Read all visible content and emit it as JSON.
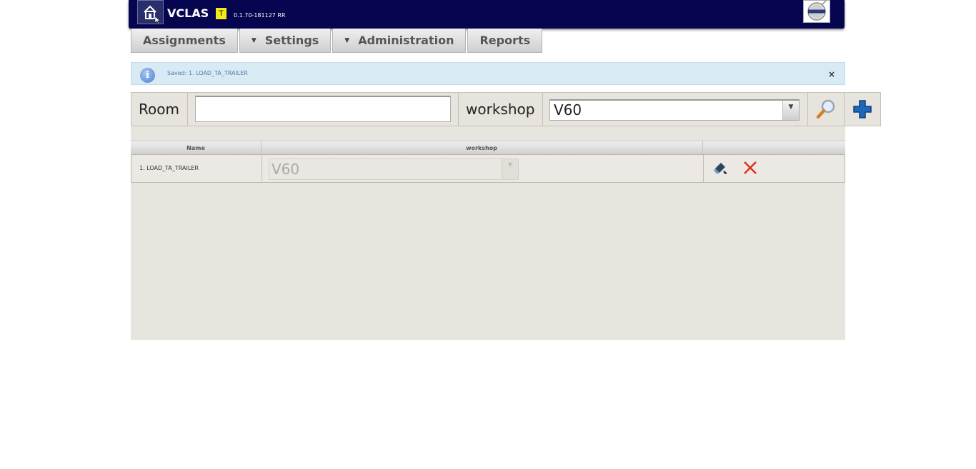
{
  "header": {
    "app_title": "VCLAS",
    "env_badge": "T",
    "version": "0.1.70-181127 RR",
    "logo_icon": "house-cursor-icon",
    "brand_logo": "volvo-logo-icon"
  },
  "menu": {
    "items": [
      {
        "label": "Assignments",
        "has_dropdown": false
      },
      {
        "label": "Settings",
        "has_dropdown": true
      },
      {
        "label": "Administration",
        "has_dropdown": true
      },
      {
        "label": "Reports",
        "has_dropdown": false
      }
    ]
  },
  "info": {
    "message": "Saved: 1. LOAD_TA_TRAILER",
    "close": "×"
  },
  "filter": {
    "room_label": "Room",
    "room_value": "",
    "workshop_label": "workshop",
    "workshop_value": "V60"
  },
  "table": {
    "columns": [
      "Name",
      "workshop"
    ],
    "rows": [
      {
        "name": "1. LOAD_TA_TRAILER",
        "workshop": "V60"
      }
    ]
  },
  "colors": {
    "header_bg": "#050550",
    "info_bg": "#d8eaf3",
    "grid_bg": "#e8e5df",
    "delete_red": "#e0301e"
  }
}
